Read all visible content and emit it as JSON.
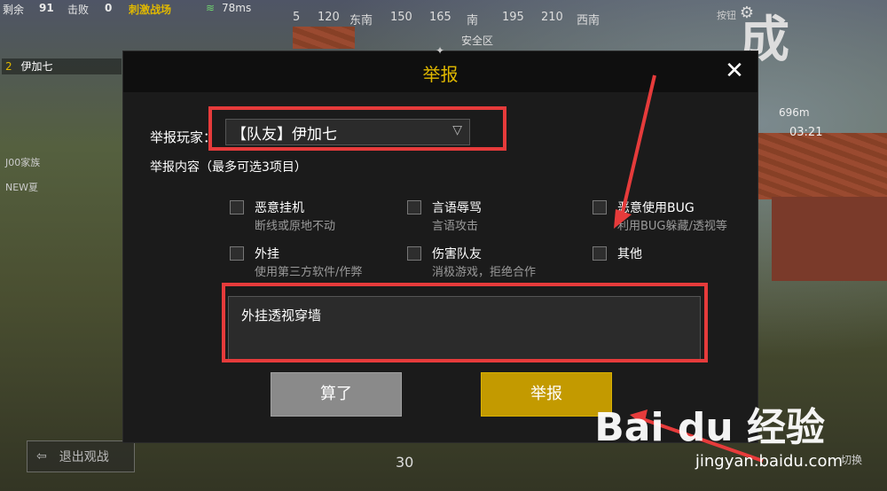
{
  "hud": {
    "remaining_label": "剩余",
    "remaining_value": "91",
    "kills_label": "击败",
    "kills_value": "0",
    "mode_badge": "刺激战场",
    "wifi_ms": "78ms",
    "shortcut_label": "按钮",
    "corner_char": "成",
    "distance": "696m",
    "timer": "03:21",
    "safe_zone": "安全区",
    "player_tag_num": "2",
    "player_tag_name": "伊加七",
    "side_row_1": "J00家族",
    "side_row_2": "NEW夏",
    "ammo_count": "30",
    "exit_label": "退出观战",
    "switch_label": "切换"
  },
  "compass": {
    "ticks": [
      "5",
      "120",
      "东南",
      "150",
      "165",
      "南",
      "195",
      "210",
      "西南"
    ]
  },
  "dialog": {
    "title": "举报",
    "player_label": "举报玩家：",
    "player_value": "【队友】伊加七",
    "content_label": "举报内容（最多可选3项目）",
    "options": [
      {
        "title": "恶意挂机",
        "desc": "断线或原地不动",
        "checked": false
      },
      {
        "title": "言语辱骂",
        "desc": "言语攻击",
        "checked": false
      },
      {
        "title": "恶意使用BUG",
        "desc": "利用BUG躲藏/透视等",
        "checked": false
      },
      {
        "title": "外挂",
        "desc": "使用第三方软件/作弊",
        "checked": false
      },
      {
        "title": "伤害队友",
        "desc": "消极游戏，拒绝合作",
        "checked": false
      },
      {
        "title": "其他",
        "desc": "",
        "checked": false
      }
    ],
    "textarea_value": "外挂透视穿墙",
    "cancel_label": "算了",
    "report_label": "举报"
  },
  "watermark": {
    "brand": "Bai du 经验",
    "url": "jingyan.baidu.com"
  },
  "colors": {
    "accent_gold": "#c39a00",
    "title_gold": "#e0b800",
    "annotation_red": "#e63b3b",
    "dialog_bg": "#1b1b1b"
  }
}
